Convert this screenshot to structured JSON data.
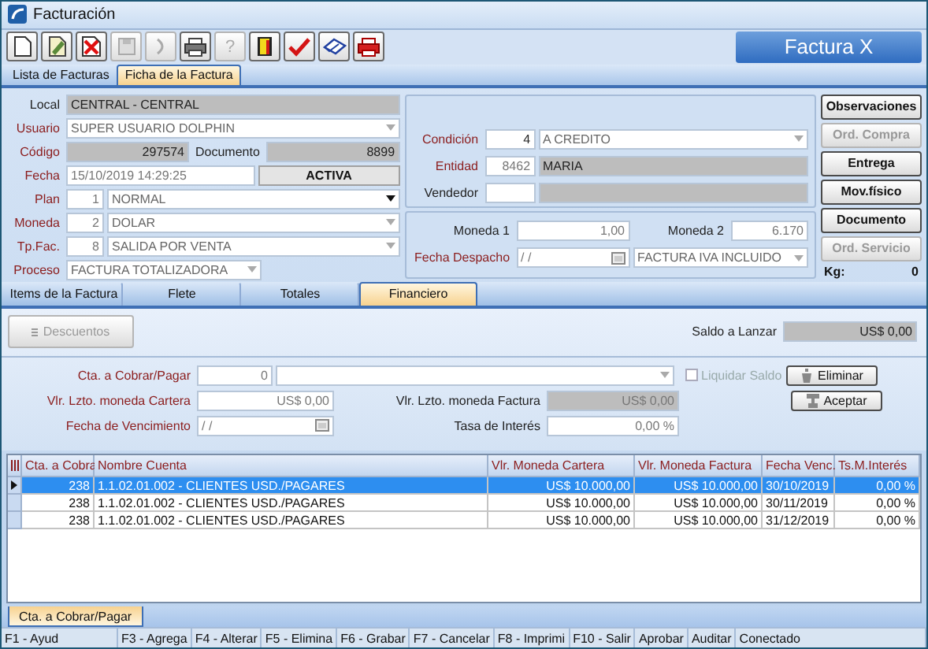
{
  "window": {
    "title": "Facturación"
  },
  "toolbar": [
    {
      "kind": "new",
      "disabled": false
    },
    {
      "kind": "edit",
      "disabled": false
    },
    {
      "kind": "delete",
      "disabled": false
    },
    {
      "kind": "save",
      "disabled": true
    },
    {
      "kind": "redo",
      "disabled": true
    },
    {
      "kind": "print",
      "disabled": false
    },
    {
      "kind": "help",
      "glyph": "?",
      "disabled": true
    },
    {
      "kind": "exit",
      "disabled": false
    },
    {
      "kind": "confirm",
      "disabled": false
    },
    {
      "kind": "erase",
      "disabled": false
    },
    {
      "kind": "print_red",
      "disabled": false
    }
  ],
  "document_type": "Factura X",
  "tabs": [
    {
      "label": "Lista de Facturas",
      "selected": false
    },
    {
      "label": "Ficha de la Factura",
      "selected": true
    }
  ],
  "header": {
    "local": {
      "label": "Local",
      "required": false,
      "value": "CENTRAL - CENTRAL"
    },
    "usuario": {
      "label": "Usuario",
      "required": true,
      "value": "SUPER USUARIO DOLPHIN",
      "disabled": true
    },
    "codigo": {
      "label": "Código",
      "required": true,
      "value": "297574"
    },
    "documento": {
      "label": "Documento",
      "required": false,
      "value": "8899"
    },
    "fecha": {
      "label": "Fecha",
      "required": true,
      "value": "15/10/2019 14:29:25"
    },
    "estado": "ACTIVA",
    "plan": {
      "label": "Plan",
      "required": true,
      "code": "1",
      "value": "NORMAL",
      "disabled": false
    },
    "moneda": {
      "label": "Moneda",
      "required": true,
      "code": "2",
      "value": "DOLAR",
      "disabled": true
    },
    "tp_fac": {
      "label": "Tp.Fac.",
      "required": true,
      "code": "8",
      "value": "SALIDA POR VENTA",
      "disabled": true
    },
    "proceso": {
      "label": "Proceso",
      "required": true,
      "value": "FACTURA TOTALIZADORA",
      "disabled": true
    },
    "condicion": {
      "label": "Condición",
      "required": true,
      "code": "4",
      "value": "A CREDITO",
      "disabled": true
    },
    "entidad": {
      "label": "Entidad",
      "required": true,
      "code": "8462",
      "value": "MARIA"
    },
    "vendedor": {
      "label": "Vendedor",
      "required": false
    },
    "moneda_1": {
      "label": "Moneda 1",
      "required": false,
      "value": "1,00"
    },
    "moneda_2": {
      "label": "Moneda 2",
      "required": false,
      "value": "6.170"
    },
    "fecha_despacho": {
      "label": "Fecha Despacho",
      "required": true,
      "value": "/ /"
    },
    "tipo_factura": {
      "value": "FACTURA IVA INCLUIDO",
      "disabled": true
    }
  },
  "side_buttons": [
    {
      "label": "Observaciones",
      "disabled": false
    },
    {
      "label": "Ord. Compra",
      "disabled": true
    },
    {
      "label": "Entrega",
      "disabled": false
    },
    {
      "label": "Mov.físico",
      "disabled": false
    },
    {
      "label": "Documento",
      "disabled": false
    },
    {
      "label": "Ord. Servicio",
      "disabled": true
    }
  ],
  "kg": {
    "label": "Kg:",
    "value": "0"
  },
  "section_tabs": [
    {
      "label": "Items de la Factura",
      "selected": false
    },
    {
      "label": "Flete",
      "selected": false
    },
    {
      "label": "Totales",
      "selected": false
    },
    {
      "label": "Financiero",
      "selected": true
    }
  ],
  "financiero": {
    "descuentos": {
      "label": "Descuentos",
      "disabled": true
    },
    "saldo": {
      "label": "Saldo a Lanzar",
      "required": false,
      "value": "US$ 0,00"
    },
    "cta": {
      "label": "Cta. a Cobrar/Pagar",
      "required": true,
      "code": "0",
      "disabled": true
    },
    "liquidar": {
      "label": "Liquidar Saldo",
      "checked": false,
      "disabled": true
    },
    "eliminar": {
      "label": "Eliminar",
      "disabled": false
    },
    "aceptar": {
      "label": "Aceptar",
      "disabled": false
    },
    "vlr_cartera": {
      "label": "Vlr. Lzto. moneda Cartera",
      "required": true,
      "value": "US$ 0,00"
    },
    "vlr_factura": {
      "label": "Vlr. Lzto. moneda Factura",
      "required": false,
      "value": "US$ 0,00"
    },
    "vencimiento": {
      "label": "Fecha de Vencimiento",
      "required": true,
      "value": "/ /"
    },
    "tasa": {
      "label": "Tasa de Interés",
      "required": false,
      "value": "0,00 %"
    }
  },
  "table": {
    "columns": [
      "Cta. a Cobra",
      "Nombre Cuenta",
      "Vlr. Moneda Cartera",
      "Vlr. Moneda Factura",
      "Fecha Venc.",
      "Ts.M.Interés"
    ],
    "rows": [
      {
        "selected": true,
        "cells": [
          "238",
          "1.1.02.01.002 - CLIENTES USD./PAGARES",
          "US$ 10.000,00",
          "US$ 10.000,00",
          "30/10/2019",
          "0,00 %"
        ]
      },
      {
        "selected": false,
        "cells": [
          "238",
          "1.1.02.01.002 - CLIENTES USD./PAGARES",
          "US$ 10.000,00",
          "US$ 10.000,00",
          "30/11/2019",
          "0,00 %"
        ]
      },
      {
        "selected": false,
        "cells": [
          "238",
          "1.1.02.01.002 - CLIENTES USD./PAGARES",
          "US$ 10.000,00",
          "US$ 10.000,00",
          "31/12/2019",
          "0,00 %"
        ]
      }
    ]
  },
  "bottom_tabs": [
    {
      "label": "Cta. a Cobrar/Pagar",
      "selected": true
    }
  ],
  "status_bar": [
    "F1 - Ayud",
    "F3 - Agrega",
    "F4 - Alterar",
    "F5 - Elimina",
    "F6 - Grabar",
    "F7 - Cancelar",
    "F8 - Imprimi",
    "F10 - Salir",
    "Aprobar",
    "Auditar",
    "Conectado"
  ]
}
